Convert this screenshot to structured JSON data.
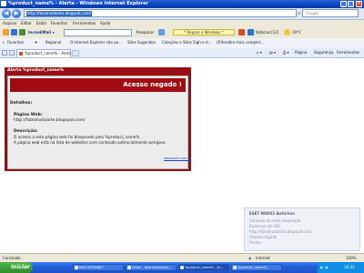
{
  "window": {
    "title": "%product_name% - Alerta - Windows Internet Explorer"
  },
  "address": {
    "url": "http://fabiohadaarte.blogspot.com/",
    "search_placeholder": "Google"
  },
  "menu": [
    "Arquivo",
    "Editar",
    "Exibir",
    "Favoritos",
    "Ferramentas",
    "Ajuda"
  ],
  "toolbar": {
    "search_label": "Pesquisar",
    "reparo_label": "* Reparo o Windows *",
    "noticias_label": "Notícias",
    "noticias_count": "[12]",
    "temp": "19°C"
  },
  "favorites": [
    "Favoritos",
    "Regional",
    "O Internet Explorer não po...",
    "Sites Sugeridos",
    "Coleções e Sites Sigh-o d...",
    "(R)ferebia mais complet..."
  ],
  "favbar_right": [
    "Página",
    "Segurança",
    "Ferramentas"
  ],
  "tab": {
    "label": "%product_name% - Aleta"
  },
  "alert": {
    "window_title": "Alerta %product_name%",
    "header": "Acesso negado !",
    "details_label": "Detalhes:",
    "page_label": "Página Web:",
    "page_url": "http://fabiohadaarte.blogspot.com/",
    "desc_label": "Descrição:",
    "desc_line1": "O acesso a esta página web foi bloqueado pelo %product_name%.",
    "desc_line2": "A página web está na lista de websites com conteúdo potencialmente perigoso.",
    "link": "www.eset.com.br"
  },
  "side_panel": {
    "title": "ESET NOD32 Antivirus",
    "lines": [
      "Conexão de rede bloqueada",
      "Endereço de URL",
      "http://fabiohadaarte.blogspot.com",
      "Acesso negado",
      "Fechar"
    ]
  },
  "status": {
    "left": "Concluído",
    "zone": "Internet",
    "zoom": "100%"
  },
  "taskbar": {
    "start": "iniciar",
    "tasks": [
      "NOD INTERNET",
      "Gmail - New submissio...",
      "%product_name% - Al...",
      "%product_name%... "
    ],
    "clock": "16:33"
  }
}
